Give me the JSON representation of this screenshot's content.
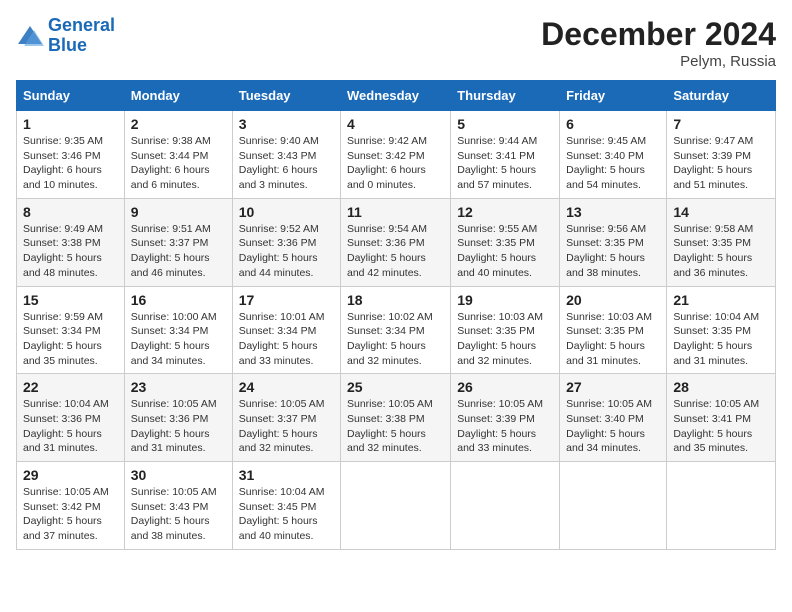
{
  "header": {
    "logo_line1": "General",
    "logo_line2": "Blue",
    "title": "December 2024",
    "subtitle": "Pelym, Russia"
  },
  "days_of_week": [
    "Sunday",
    "Monday",
    "Tuesday",
    "Wednesday",
    "Thursday",
    "Friday",
    "Saturday"
  ],
  "weeks": [
    [
      {
        "num": "1",
        "sunrise": "9:35 AM",
        "sunset": "3:46 PM",
        "daylight": "6 hours and 10 minutes."
      },
      {
        "num": "2",
        "sunrise": "9:38 AM",
        "sunset": "3:44 PM",
        "daylight": "6 hours and 6 minutes."
      },
      {
        "num": "3",
        "sunrise": "9:40 AM",
        "sunset": "3:43 PM",
        "daylight": "6 hours and 3 minutes."
      },
      {
        "num": "4",
        "sunrise": "9:42 AM",
        "sunset": "3:42 PM",
        "daylight": "6 hours and 0 minutes."
      },
      {
        "num": "5",
        "sunrise": "9:44 AM",
        "sunset": "3:41 PM",
        "daylight": "5 hours and 57 minutes."
      },
      {
        "num": "6",
        "sunrise": "9:45 AM",
        "sunset": "3:40 PM",
        "daylight": "5 hours and 54 minutes."
      },
      {
        "num": "7",
        "sunrise": "9:47 AM",
        "sunset": "3:39 PM",
        "daylight": "5 hours and 51 minutes."
      }
    ],
    [
      {
        "num": "8",
        "sunrise": "9:49 AM",
        "sunset": "3:38 PM",
        "daylight": "5 hours and 48 minutes."
      },
      {
        "num": "9",
        "sunrise": "9:51 AM",
        "sunset": "3:37 PM",
        "daylight": "5 hours and 46 minutes."
      },
      {
        "num": "10",
        "sunrise": "9:52 AM",
        "sunset": "3:36 PM",
        "daylight": "5 hours and 44 minutes."
      },
      {
        "num": "11",
        "sunrise": "9:54 AM",
        "sunset": "3:36 PM",
        "daylight": "5 hours and 42 minutes."
      },
      {
        "num": "12",
        "sunrise": "9:55 AM",
        "sunset": "3:35 PM",
        "daylight": "5 hours and 40 minutes."
      },
      {
        "num": "13",
        "sunrise": "9:56 AM",
        "sunset": "3:35 PM",
        "daylight": "5 hours and 38 minutes."
      },
      {
        "num": "14",
        "sunrise": "9:58 AM",
        "sunset": "3:35 PM",
        "daylight": "5 hours and 36 minutes."
      }
    ],
    [
      {
        "num": "15",
        "sunrise": "9:59 AM",
        "sunset": "3:34 PM",
        "daylight": "5 hours and 35 minutes."
      },
      {
        "num": "16",
        "sunrise": "10:00 AM",
        "sunset": "3:34 PM",
        "daylight": "5 hours and 34 minutes."
      },
      {
        "num": "17",
        "sunrise": "10:01 AM",
        "sunset": "3:34 PM",
        "daylight": "5 hours and 33 minutes."
      },
      {
        "num": "18",
        "sunrise": "10:02 AM",
        "sunset": "3:34 PM",
        "daylight": "5 hours and 32 minutes."
      },
      {
        "num": "19",
        "sunrise": "10:03 AM",
        "sunset": "3:35 PM",
        "daylight": "5 hours and 32 minutes."
      },
      {
        "num": "20",
        "sunrise": "10:03 AM",
        "sunset": "3:35 PM",
        "daylight": "5 hours and 31 minutes."
      },
      {
        "num": "21",
        "sunrise": "10:04 AM",
        "sunset": "3:35 PM",
        "daylight": "5 hours and 31 minutes."
      }
    ],
    [
      {
        "num": "22",
        "sunrise": "10:04 AM",
        "sunset": "3:36 PM",
        "daylight": "5 hours and 31 minutes."
      },
      {
        "num": "23",
        "sunrise": "10:05 AM",
        "sunset": "3:36 PM",
        "daylight": "5 hours and 31 minutes."
      },
      {
        "num": "24",
        "sunrise": "10:05 AM",
        "sunset": "3:37 PM",
        "daylight": "5 hours and 32 minutes."
      },
      {
        "num": "25",
        "sunrise": "10:05 AM",
        "sunset": "3:38 PM",
        "daylight": "5 hours and 32 minutes."
      },
      {
        "num": "26",
        "sunrise": "10:05 AM",
        "sunset": "3:39 PM",
        "daylight": "5 hours and 33 minutes."
      },
      {
        "num": "27",
        "sunrise": "10:05 AM",
        "sunset": "3:40 PM",
        "daylight": "5 hours and 34 minutes."
      },
      {
        "num": "28",
        "sunrise": "10:05 AM",
        "sunset": "3:41 PM",
        "daylight": "5 hours and 35 minutes."
      }
    ],
    [
      {
        "num": "29",
        "sunrise": "10:05 AM",
        "sunset": "3:42 PM",
        "daylight": "5 hours and 37 minutes."
      },
      {
        "num": "30",
        "sunrise": "10:05 AM",
        "sunset": "3:43 PM",
        "daylight": "5 hours and 38 minutes."
      },
      {
        "num": "31",
        "sunrise": "10:04 AM",
        "sunset": "3:45 PM",
        "daylight": "5 hours and 40 minutes."
      },
      null,
      null,
      null,
      null
    ]
  ]
}
